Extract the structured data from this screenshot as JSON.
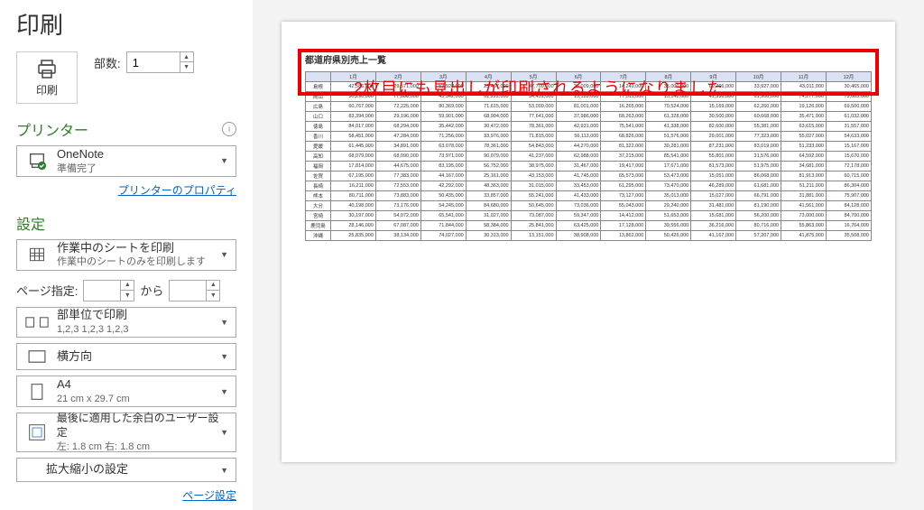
{
  "title": "印刷",
  "printButton": {
    "label": "印刷"
  },
  "copies": {
    "label": "部数:",
    "value": "1"
  },
  "printerSection": {
    "title": "プリンター"
  },
  "printerDropdown": {
    "main": "OneNote",
    "sub": "準備完了"
  },
  "printerPropsLink": "プリンターのプロパティ",
  "settingsSection": {
    "title": "設定"
  },
  "printWhat": {
    "main": "作業中のシートを印刷",
    "sub": "作業中のシートのみを印刷します"
  },
  "pageRange": {
    "label": "ページ指定:",
    "toLabel": "から"
  },
  "collate": {
    "main": "部単位で印刷",
    "sub": "1,2,3    1,2,3    1,2,3"
  },
  "orientation": {
    "main": "横方向"
  },
  "paperSize": {
    "main": "A4",
    "sub": "21 cm x 29.7 cm"
  },
  "margins": {
    "main": "最後に適用した余白のユーザー設定",
    "sub": "左: 1.8 cm    右: 1.8 cm"
  },
  "scaling": {
    "main": "拡大縮小の設定"
  },
  "pageSetupLink": "ページ設定",
  "preview": {
    "sheetTitle": "都道府県別売上一覧",
    "annotation": "2枚目にも見出しが印刷されるようになりました",
    "months": [
      "1月",
      "2月",
      "3月",
      "4月",
      "5月",
      "6月",
      "7月",
      "8月",
      "9月",
      "10月",
      "11月",
      "12月"
    ],
    "rows": [
      {
        "pref": "島根",
        "v": [
          "42,586,000",
          "29,571,000",
          "53,928,000",
          "25,467,000",
          "47,709,000",
          "36,009,000",
          "14,249,000",
          "35,000,000",
          "69,766,000",
          "33,927,000",
          "43,011,000",
          "30,465,000"
        ]
      },
      {
        "pref": "岡山",
        "v": [
          "30,290,000",
          "77,888,000",
          "43,542,000",
          "61,222,000",
          "34,431,000",
          "15,128,000",
          "77,511,000",
          "15,140,000",
          "41,336,000",
          "61,900,000",
          "74,277,000",
          "73,683,000"
        ]
      },
      {
        "pref": "広島",
        "v": [
          "60,767,000",
          "72,225,000",
          "80,369,000",
          "71,615,000",
          "53,009,000",
          "81,001,000",
          "16,265,000",
          "70,524,000",
          "15,169,000",
          "62,260,000",
          "19,126,000",
          "69,500,000"
        ]
      },
      {
        "pref": "山口",
        "v": [
          "83,394,000",
          "29,196,000",
          "59,901,000",
          "68,994,000",
          "77,641,000",
          "37,986,000",
          "68,263,000",
          "61,328,000",
          "30,500,000",
          "60,668,000",
          "35,471,000",
          "61,032,000"
        ]
      },
      {
        "pref": "徳島",
        "v": [
          "84,017,000",
          "68,294,000",
          "35,442,000",
          "30,472,000",
          "78,361,000",
          "42,931,000",
          "75,541,000",
          "41,338,000",
          "82,600,000",
          "55,381,000",
          "63,615,000",
          "31,557,000"
        ]
      },
      {
        "pref": "香川",
        "v": [
          "58,451,000",
          "47,284,000",
          "71,256,000",
          "33,976,000",
          "71,815,000",
          "56,113,000",
          "68,826,000",
          "51,576,000",
          "29,001,000",
          "77,323,000",
          "55,027,000",
          "54,633,000"
        ]
      },
      {
        "pref": "愛媛",
        "v": [
          "61,445,000",
          "34,891,000",
          "63,078,000",
          "78,361,000",
          "54,843,000",
          "44,270,000",
          "81,322,000",
          "30,281,000",
          "87,231,000",
          "83,019,000",
          "51,233,000",
          "15,167,000"
        ]
      },
      {
        "pref": "高知",
        "v": [
          "68,079,000",
          "68,090,000",
          "73,971,000",
          "90,079,000",
          "41,237,000",
          "62,988,000",
          "37,215,000",
          "85,541,000",
          "55,801,000",
          "31,576,000",
          "64,592,000",
          "15,670,000"
        ]
      },
      {
        "pref": "福岡",
        "v": [
          "17,814,000",
          "44,675,000",
          "83,195,000",
          "56,752,000",
          "38,975,000",
          "31,467,000",
          "19,417,000",
          "17,671,000",
          "81,573,000",
          "51,975,000",
          "34,681,000",
          "72,178,000"
        ]
      },
      {
        "pref": "佐賀",
        "v": [
          "67,195,000",
          "77,383,000",
          "44,167,000",
          "25,161,000",
          "43,153,000",
          "41,745,000",
          "65,573,000",
          "53,473,000",
          "15,051,000",
          "86,068,000",
          "81,913,000",
          "60,715,000"
        ]
      },
      {
        "pref": "長崎",
        "v": [
          "16,211,000",
          "72,553,000",
          "42,292,000",
          "48,363,000",
          "31,015,000",
          "33,453,000",
          "61,295,000",
          "73,470,000",
          "46,289,000",
          "61,681,000",
          "51,211,000",
          "86,304,000"
        ]
      },
      {
        "pref": "熊本",
        "v": [
          "80,711,000",
          "73,883,000",
          "50,435,000",
          "33,857,000",
          "55,241,000",
          "41,433,000",
          "73,127,000",
          "35,013,000",
          "15,027,000",
          "66,791,000",
          "31,881,000",
          "75,907,000"
        ]
      },
      {
        "pref": "大分",
        "v": [
          "40,198,000",
          "73,176,000",
          "54,245,000",
          "84,680,000",
          "50,645,000",
          "73,036,000",
          "55,043,000",
          "29,240,000",
          "31,481,000",
          "81,190,000",
          "41,561,000",
          "84,128,000"
        ]
      },
      {
        "pref": "宮崎",
        "v": [
          "30,197,000",
          "54,072,000",
          "65,541,000",
          "31,027,000",
          "73,087,000",
          "59,347,000",
          "14,412,000",
          "51,653,000",
          "15,681,000",
          "56,200,000",
          "73,000,000",
          "84,700,000"
        ]
      },
      {
        "pref": "鹿児島",
        "v": [
          "28,146,000",
          "67,087,000",
          "71,844,000",
          "58,384,000",
          "25,841,000",
          "63,425,000",
          "17,128,000",
          "39,556,000",
          "36,216,000",
          "80,716,000",
          "55,863,000",
          "16,764,000"
        ]
      },
      {
        "pref": "沖縄",
        "v": [
          "25,835,000",
          "38,134,000",
          "74,027,000",
          "30,313,000",
          "13,151,000",
          "38,908,000",
          "13,862,000",
          "50,426,000",
          "41,167,000",
          "57,207,000",
          "41,875,000",
          "35,508,000"
        ]
      }
    ]
  }
}
